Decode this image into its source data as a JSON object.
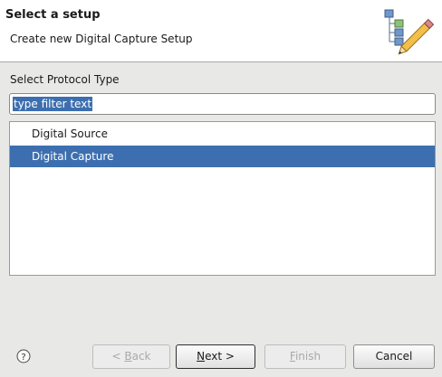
{
  "header": {
    "title": "Select a setup",
    "description": "Create new Digital Capture Setup"
  },
  "protocol": {
    "label": "Select Protocol Type",
    "filter_value": "type filter text",
    "items": [
      {
        "label": "Digital Source",
        "selected": false
      },
      {
        "label": "Digital Capture",
        "selected": true
      }
    ]
  },
  "buttons": {
    "back_mnemonic": "B",
    "back_rest": "ack",
    "back_prefix": "< ",
    "next_mnemonic": "N",
    "next_rest": "ext >",
    "finish_mnemonic": "F",
    "finish_rest": "inish",
    "cancel": "Cancel"
  },
  "icons": {
    "help": "help-icon",
    "banner": "wizard-hierarchy-pencil-icon"
  },
  "colors": {
    "selection": "#3d6fb0",
    "header_bg": "#ffffff",
    "dialog_bg": "#e8e8e7"
  }
}
